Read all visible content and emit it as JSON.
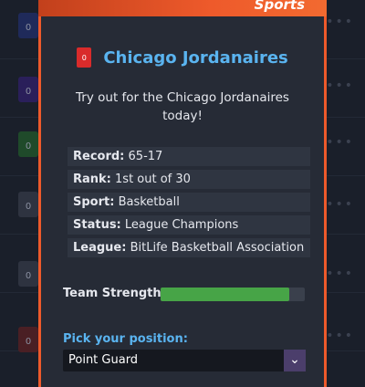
{
  "modal": {
    "header_title": "Sports",
    "team_name": "Chicago Jordanaires",
    "team_icon": "jersey-icon",
    "tryout_text": "Try out for the Chicago Jordanaires today!",
    "info": [
      {
        "key": "Record:",
        "value": "65-17"
      },
      {
        "key": "Rank:",
        "value": "1st out of 30"
      },
      {
        "key": "Sport:",
        "value": "Basketball"
      },
      {
        "key": "Status:",
        "value": "League Champions"
      },
      {
        "key": "League:",
        "value": "BitLife Basketball Association"
      }
    ],
    "team_strength_label": "Team Strength",
    "team_strength_fraction": 0.89,
    "pick_position_label": "Pick your position:",
    "position_select_value": "Point Guard",
    "colors": {
      "accent": "#ee5a2b",
      "team_name": "#5ab4f0",
      "strength_bar": "#47a447"
    }
  },
  "background_list": {
    "jersey_label": "0",
    "menu_icon": "ellipsis-icon"
  }
}
